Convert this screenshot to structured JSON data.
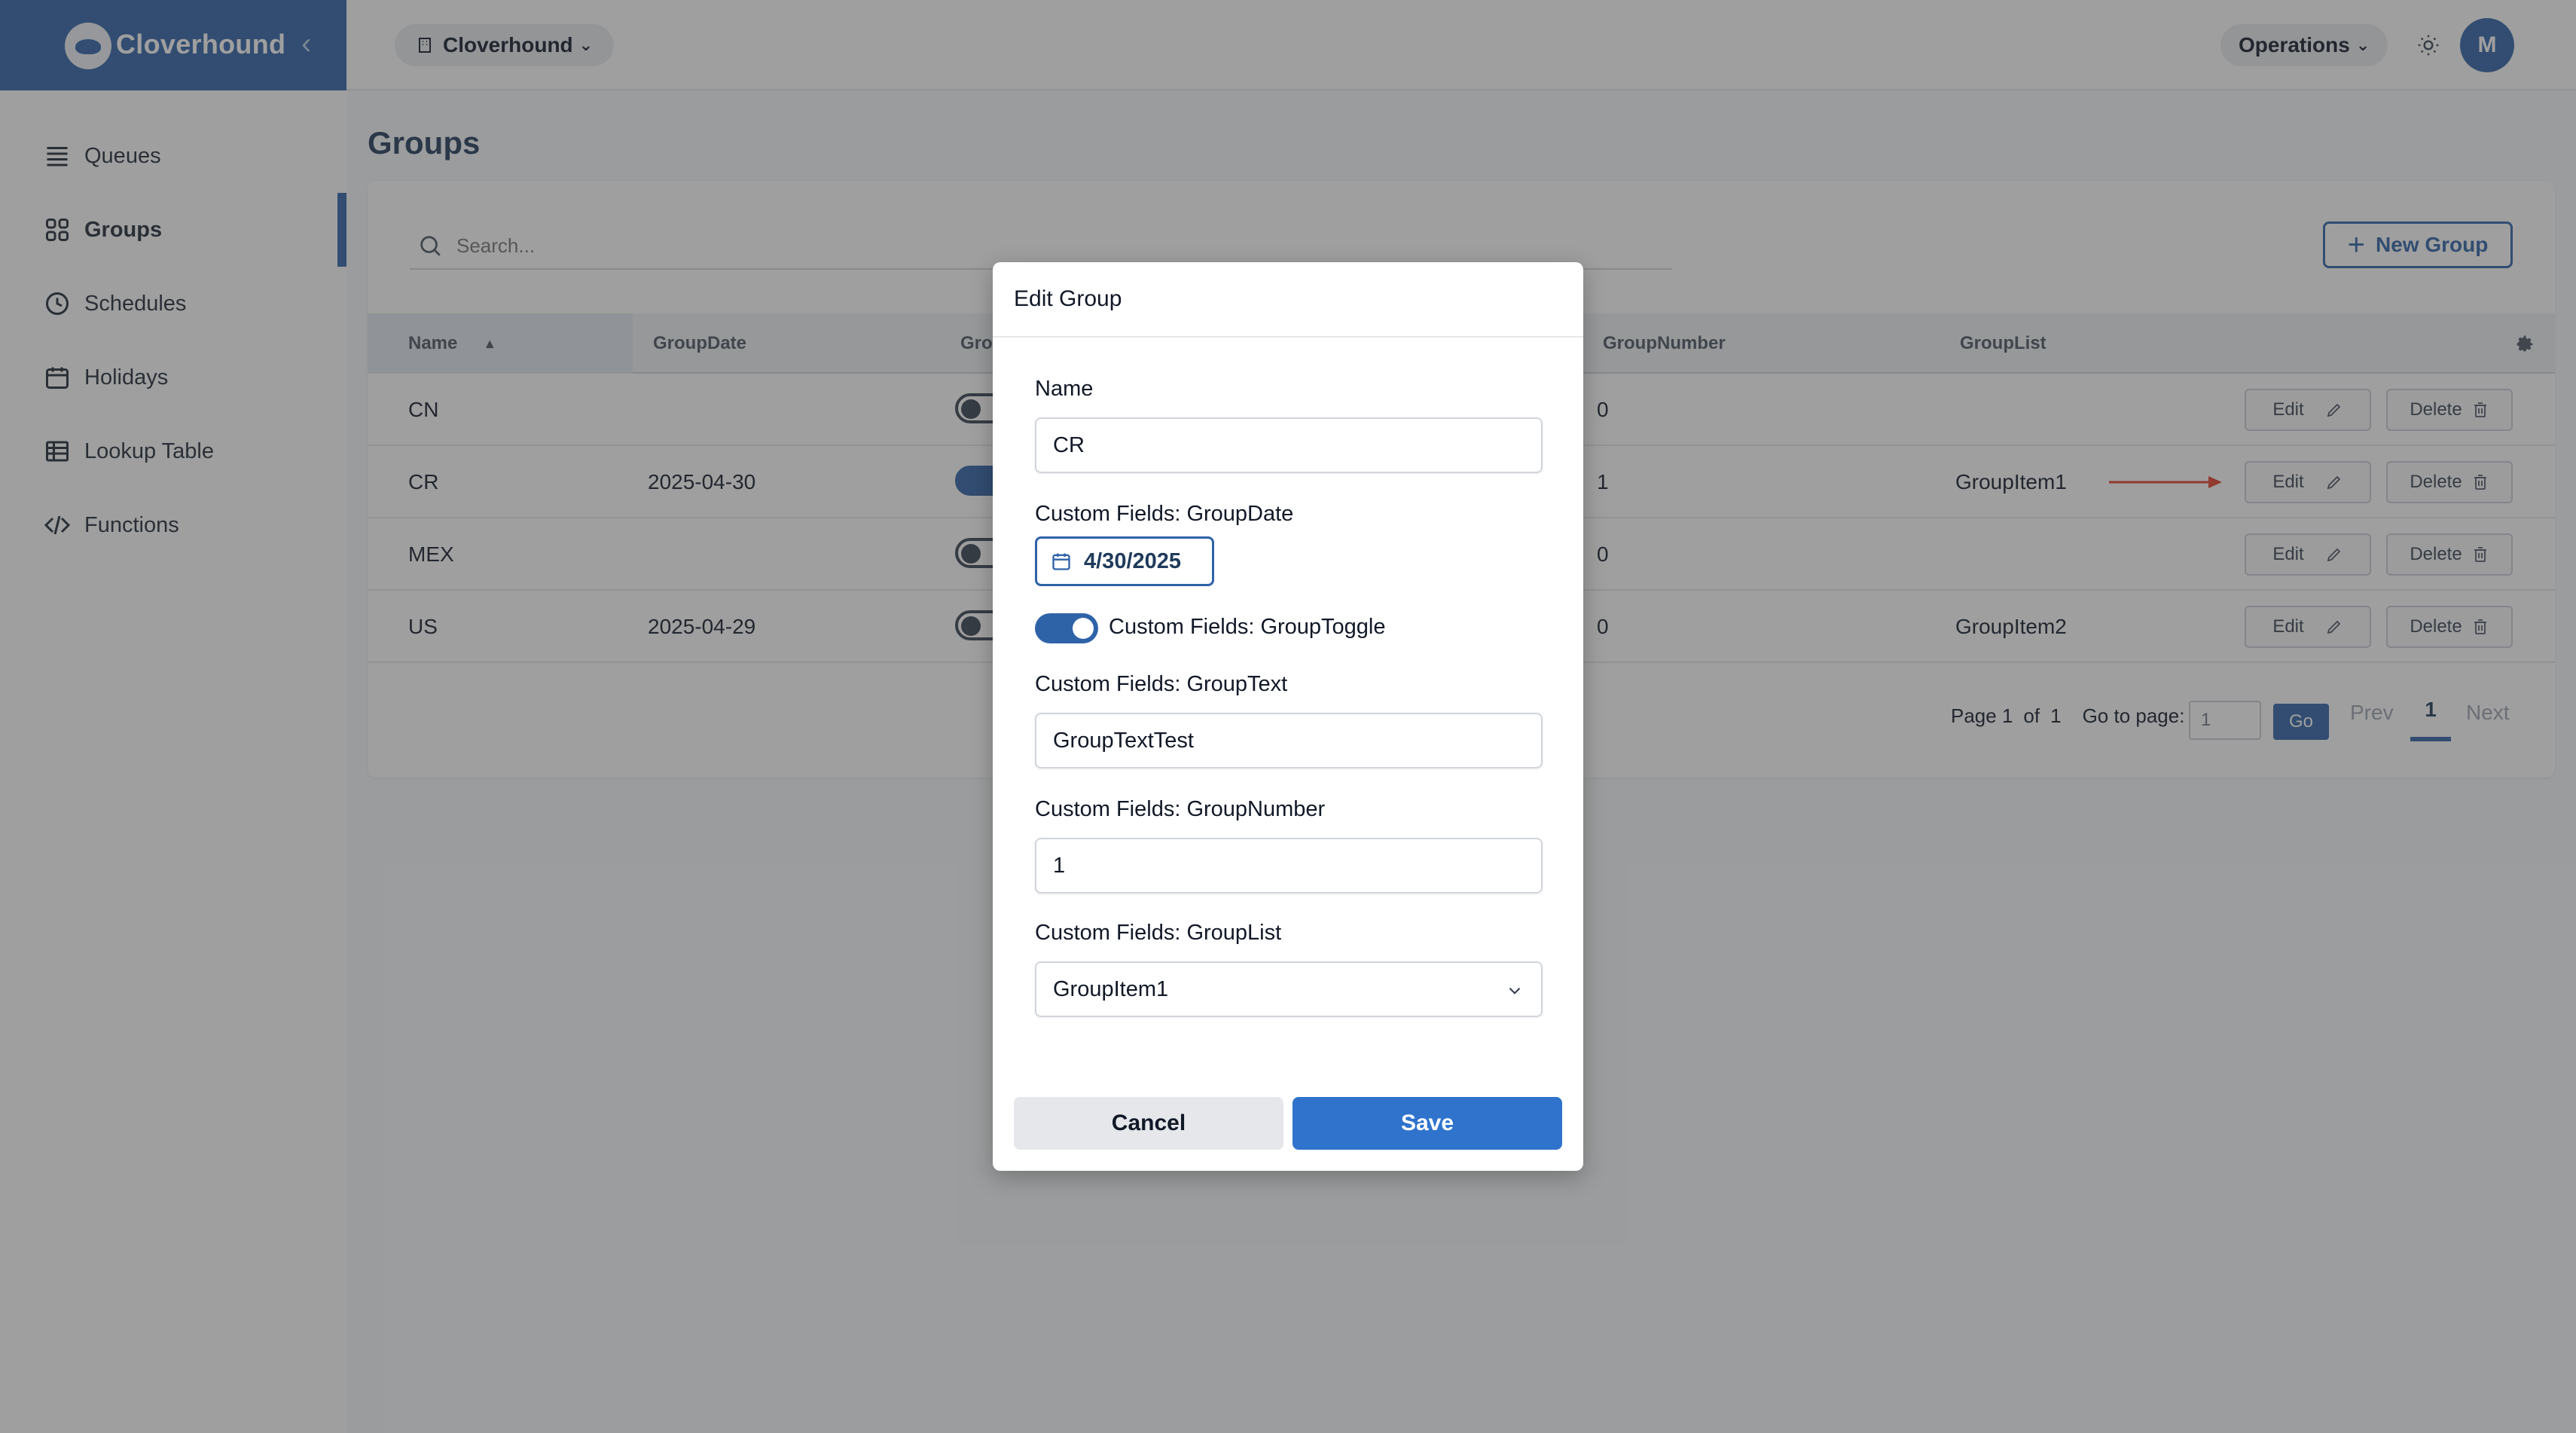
{
  "app": {
    "brand_name": "Cloverhound",
    "accent_color": "#2f63a8"
  },
  "sidebar": {
    "items": [
      {
        "label": "Queues",
        "icon": "list-icon",
        "active": false
      },
      {
        "label": "Groups",
        "icon": "grid-icon",
        "active": true
      },
      {
        "label": "Schedules",
        "icon": "clock-icon",
        "active": false
      },
      {
        "label": "Holidays",
        "icon": "calendar-icon",
        "active": false
      },
      {
        "label": "Lookup Table",
        "icon": "table-icon",
        "active": false
      },
      {
        "label": "Functions",
        "icon": "code-icon",
        "active": false
      }
    ]
  },
  "topbar": {
    "org_label": "Cloverhound",
    "ops_label": "Operations",
    "avatar_initial": "M"
  },
  "page": {
    "title": "Groups",
    "search_placeholder": "Search...",
    "new_group_label": "New Group"
  },
  "table": {
    "headers": [
      "Name",
      "GroupDate",
      "Gro",
      "GroupNumber",
      "GroupList"
    ],
    "sorted_column": "Name",
    "sort_direction": "ascending",
    "rows": [
      {
        "name": "CN",
        "date": "",
        "toggle": false,
        "number": "0",
        "list": ""
      },
      {
        "name": "CR",
        "date": "2025-04-30",
        "toggle": true,
        "number": "1",
        "list": "GroupItem1"
      },
      {
        "name": "MEX",
        "date": "",
        "toggle": false,
        "number": "0",
        "list": ""
      },
      {
        "name": "US",
        "date": "2025-04-29",
        "toggle": false,
        "number": "0",
        "list": "GroupItem2"
      }
    ],
    "edit_label": "Edit",
    "delete_label": "Delete"
  },
  "pagination": {
    "page_label": "Page 1",
    "of_label": "of",
    "total_pages": "1",
    "goto_label": "Go to page:",
    "goto_value": "1",
    "go_label": "Go",
    "prev_label": "Prev",
    "current": "1",
    "next_label": "Next"
  },
  "modal": {
    "title": "Edit Group",
    "name_label": "Name",
    "name_value": "CR",
    "date_label": "Custom Fields: GroupDate",
    "date_value": "4/30/2025",
    "toggle_label": "Custom Fields: GroupToggle",
    "toggle_on": true,
    "text_label": "Custom Fields: GroupText",
    "text_value": "GroupTextTest",
    "number_label": "Custom Fields: GroupNumber",
    "number_value": "1",
    "list_label": "Custom Fields: GroupList",
    "list_value": "GroupItem1",
    "cancel_label": "Cancel",
    "save_label": "Save"
  }
}
